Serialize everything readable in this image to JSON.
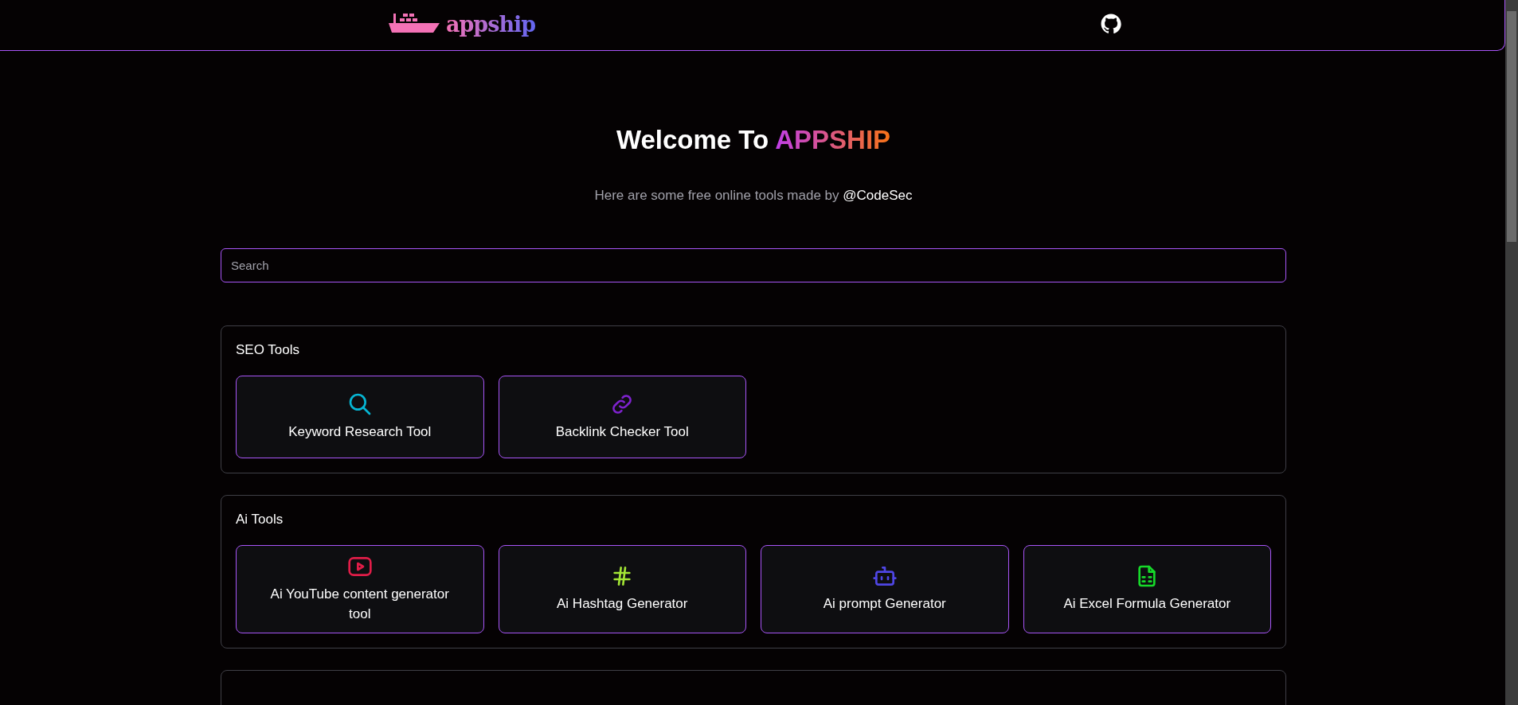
{
  "header": {
    "logo_text": "appship"
  },
  "hero": {
    "title": "Welcome To",
    "brand": "APPSHIP",
    "subtitle": "Here are some free online tools made by",
    "author_link": "@CodeSec"
  },
  "search": {
    "placeholder": "Search"
  },
  "sections": [
    {
      "title": "SEO Tools",
      "tools": [
        {
          "name": "Keyword Research Tool",
          "kind": "search",
          "color": "#06b6d4"
        },
        {
          "name": "Backlink Checker Tool",
          "kind": "link",
          "color": "#7e22ce"
        }
      ]
    },
    {
      "title": "Ai Tools",
      "tools": [
        {
          "name": "Ai YouTube content generator tool",
          "kind": "video",
          "color": "#e11d48"
        },
        {
          "name": "Ai Hashtag Generator",
          "kind": "hash",
          "color": "#a3e635"
        },
        {
          "name": "Ai prompt Generator",
          "kind": "robot",
          "color": "#4f46e5"
        },
        {
          "name": "Ai Excel Formula Generator",
          "kind": "sheet",
          "color": "#16d92a"
        }
      ]
    }
  ]
}
